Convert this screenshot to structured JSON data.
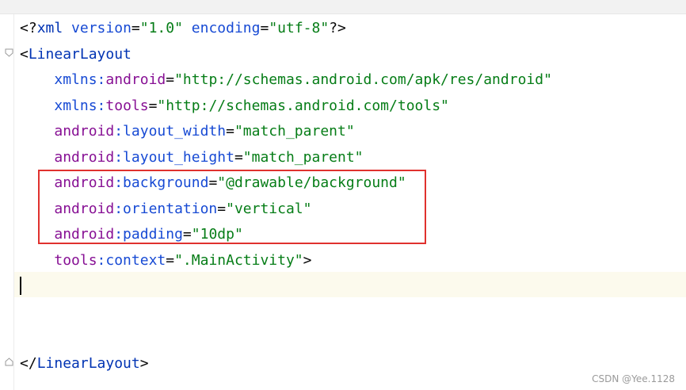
{
  "editor": {
    "lines": [
      {
        "parts": [
          {
            "t": "<?",
            "c": "c-plain"
          },
          {
            "t": "xml",
            "c": "c-tag"
          },
          {
            "t": " ",
            "c": "c-plain"
          },
          {
            "t": "version",
            "c": "c-attr"
          },
          {
            "t": "=",
            "c": "c-plain"
          },
          {
            "t": "\"1.0\"",
            "c": "c-str"
          },
          {
            "t": " ",
            "c": "c-plain"
          },
          {
            "t": "encoding",
            "c": "c-attr"
          },
          {
            "t": "=",
            "c": "c-plain"
          },
          {
            "t": "\"utf-8\"",
            "c": "c-str"
          },
          {
            "t": "?>",
            "c": "c-plain"
          }
        ]
      },
      {
        "parts": [
          {
            "t": "<",
            "c": "c-plain"
          },
          {
            "t": "LinearLayout",
            "c": "c-tag"
          }
        ]
      },
      {
        "parts": [
          {
            "t": "    ",
            "c": "c-plain"
          },
          {
            "t": "xmlns:",
            "c": "c-attr"
          },
          {
            "t": "android",
            "c": "c-ns"
          },
          {
            "t": "=",
            "c": "c-plain"
          },
          {
            "t": "\"http://schemas.android.com/apk/res/android\"",
            "c": "c-str"
          }
        ]
      },
      {
        "parts": [
          {
            "t": "    ",
            "c": "c-plain"
          },
          {
            "t": "xmlns:",
            "c": "c-attr"
          },
          {
            "t": "tools",
            "c": "c-ns"
          },
          {
            "t": "=",
            "c": "c-plain"
          },
          {
            "t": "\"http://schemas.android.com/tools\"",
            "c": "c-str"
          }
        ]
      },
      {
        "parts": [
          {
            "t": "    ",
            "c": "c-plain"
          },
          {
            "t": "android",
            "c": "c-ns"
          },
          {
            "t": ":layout_width",
            "c": "c-attr"
          },
          {
            "t": "=",
            "c": "c-plain"
          },
          {
            "t": "\"match_parent\"",
            "c": "c-str"
          }
        ]
      },
      {
        "parts": [
          {
            "t": "    ",
            "c": "c-plain"
          },
          {
            "t": "android",
            "c": "c-ns"
          },
          {
            "t": ":layout_height",
            "c": "c-attr"
          },
          {
            "t": "=",
            "c": "c-plain"
          },
          {
            "t": "\"match_parent\"",
            "c": "c-str"
          }
        ]
      },
      {
        "parts": [
          {
            "t": "    ",
            "c": "c-plain"
          },
          {
            "t": "android",
            "c": "c-ns"
          },
          {
            "t": ":background",
            "c": "c-attr"
          },
          {
            "t": "=",
            "c": "c-plain"
          },
          {
            "t": "\"@drawable/background\"",
            "c": "c-str"
          }
        ]
      },
      {
        "parts": [
          {
            "t": "    ",
            "c": "c-plain"
          },
          {
            "t": "android",
            "c": "c-ns"
          },
          {
            "t": ":orientation",
            "c": "c-attr"
          },
          {
            "t": "=",
            "c": "c-plain"
          },
          {
            "t": "\"vertical\"",
            "c": "c-str"
          }
        ]
      },
      {
        "parts": [
          {
            "t": "    ",
            "c": "c-plain"
          },
          {
            "t": "android",
            "c": "c-ns"
          },
          {
            "t": ":padding",
            "c": "c-attr"
          },
          {
            "t": "=",
            "c": "c-plain"
          },
          {
            "t": "\"10dp\"",
            "c": "c-str"
          }
        ]
      },
      {
        "parts": [
          {
            "t": "    ",
            "c": "c-plain"
          },
          {
            "t": "tools",
            "c": "c-ns"
          },
          {
            "t": ":context",
            "c": "c-attr"
          },
          {
            "t": "=",
            "c": "c-plain"
          },
          {
            "t": "\".MainActivity\"",
            "c": "c-str"
          },
          {
            "t": ">",
            "c": "c-plain"
          }
        ]
      },
      {
        "parts": []
      },
      {
        "parts": []
      },
      {
        "parts": []
      },
      {
        "parts": [
          {
            "t": "</",
            "c": "c-plain"
          },
          {
            "t": "LinearLayout",
            "c": "c-tag"
          },
          {
            "t": ">",
            "c": "c-plain"
          }
        ]
      }
    ]
  },
  "icons": {
    "fold_open": "fold-open-icon",
    "fold_close": "fold-close-icon"
  },
  "colors": {
    "highlight_border": "#e0312e",
    "tag": "#0033b3",
    "namespace": "#871094",
    "attribute": "#174ad4",
    "string": "#067d17",
    "caret_row": "#fcfaed"
  },
  "watermark": "CSDN @Yee.1128"
}
